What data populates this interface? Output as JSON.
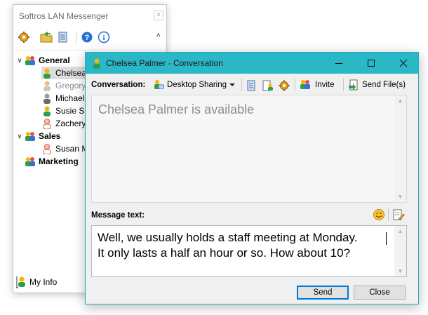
{
  "main_window": {
    "title": "Softros LAN Messenger",
    "close_glyph": "×",
    "collapse_glyph": "˄",
    "toolbar_icons": [
      "settings-gear-icon",
      "open-folder-icon",
      "history-log-icon",
      "help-icon",
      "info-icon"
    ],
    "groups": [
      {
        "name": "General",
        "expanded": true,
        "users": [
          {
            "name": "Chelsea Palmer",
            "visible_text": "Chelsea",
            "status": "available",
            "selected": true
          },
          {
            "name": "Gregory",
            "visible_text": "Gregory",
            "status": "away",
            "selected": false
          },
          {
            "name": "Michael",
            "visible_text": "Michael",
            "status": "offline",
            "selected": false
          },
          {
            "name": "Susie Sa",
            "visible_text": "Susie Sa",
            "status": "available",
            "selected": false
          },
          {
            "name": "Zachery",
            "visible_text": "Zachery",
            "status": "busy",
            "selected": false
          }
        ]
      },
      {
        "name": "Sales",
        "expanded": true,
        "users": [
          {
            "name": "Susan M",
            "visible_text": "Susan M",
            "status": "busy",
            "selected": false
          }
        ]
      },
      {
        "name": "Marketing",
        "expanded": false,
        "users": []
      }
    ],
    "my_info_label": "My Info"
  },
  "conversation": {
    "title": "Chelsea Palmer - Conversation",
    "conversation_label": "Conversation:",
    "desktop_sharing_label": "Desktop Sharing",
    "invite_label": "Invite",
    "send_files_label": "Send File(s)",
    "status_message": "Chelsea Palmer is available",
    "message_label": "Message text:",
    "message_text": "Well, we usually holds a staff meeting at Monday.\nIt only lasts a half an hour or so. How about 10?",
    "send_label": "Send",
    "close_label": "Close"
  },
  "colors": {
    "title_bar": "#2ab7c6",
    "available": "#f5b400",
    "away": "#c8c8c8",
    "offline": "#7a7a7a",
    "busy": "#e05050"
  }
}
